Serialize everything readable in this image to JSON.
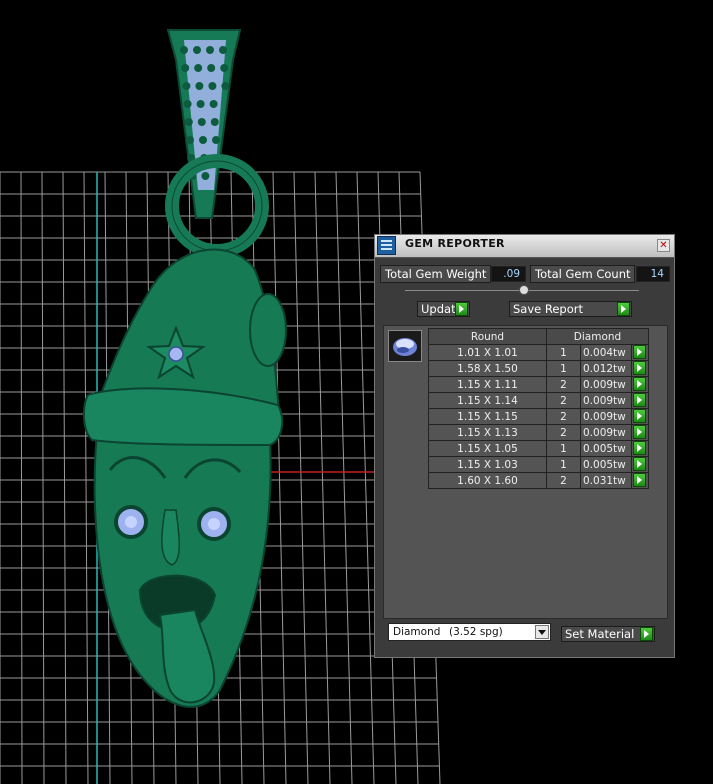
{
  "viewport": {
    "background": "#000000",
    "model_color": "#167a55",
    "gem_color": "#9fb2f0",
    "grid_color": "#9a9a9a",
    "axis_red": "#c22020",
    "axis_cyan": "#2bb7b7"
  },
  "panel": {
    "title": "GEM REPORTER",
    "title_icon": "gem-reporter-icon",
    "close_icon": "close-icon",
    "total_weight_label": "Total Gem Weight",
    "total_weight_value": ".09",
    "total_count_label": "Total Gem Count",
    "total_count_value": "14",
    "update_label": "Update",
    "save_report_label": "Save Report",
    "gem_shape": "Round",
    "gem_material": "Diamond",
    "gem_thumb_icon": "round-gem-icon",
    "rows": [
      {
        "size": "1.01 X 1.01",
        "count": "1",
        "weight": "0.004tw"
      },
      {
        "size": "1.58 X 1.50",
        "count": "1",
        "weight": "0.012tw"
      },
      {
        "size": "1.15 X 1.11",
        "count": "2",
        "weight": "0.009tw"
      },
      {
        "size": "1.15 X 1.14",
        "count": "2",
        "weight": "0.009tw"
      },
      {
        "size": "1.15 X 1.15",
        "count": "2",
        "weight": "0.009tw"
      },
      {
        "size": "1.15 X 1.13",
        "count": "2",
        "weight": "0.009tw"
      },
      {
        "size": "1.15 X 1.05",
        "count": "1",
        "weight": "0.005tw"
      },
      {
        "size": "1.15 X 1.03",
        "count": "1",
        "weight": "0.005tw"
      },
      {
        "size": "1.60 X 1.60",
        "count": "2",
        "weight": "0.031tw"
      }
    ],
    "material_select": "Diamond",
    "material_spg": "(3.52 spg)",
    "set_material_label": "Set Material"
  }
}
